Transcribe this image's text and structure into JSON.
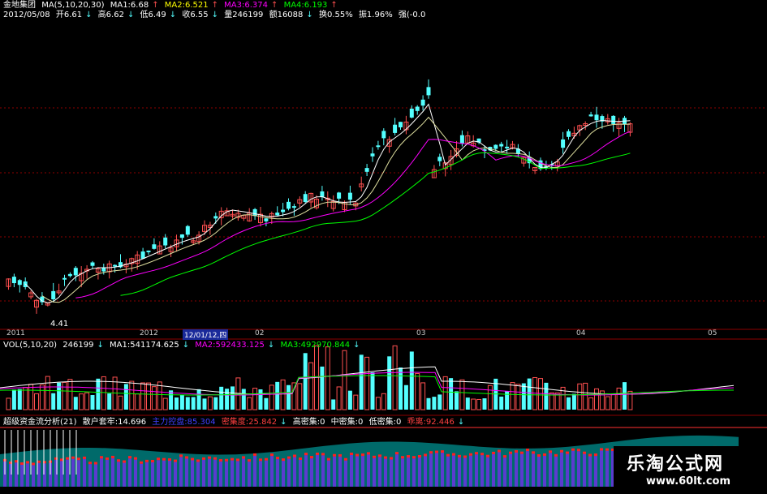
{
  "title_bar": {
    "stock_name": "金地集团",
    "ma_spec": "MA(5,10,20,30)",
    "ma1": "MA1:6.68",
    "ma2": "MA2:6.521",
    "ma3": "MA3:6.374",
    "ma4": "MA4:6.193"
  },
  "quote_bar": {
    "date": "2012/05/08",
    "open": "开6.61",
    "high": "高6.62",
    "low": "低6.49",
    "close": "收6.55",
    "volume": "量246199",
    "amount": "额16088",
    "turnover": "换0.55%",
    "amplitude": "振1.96%",
    "strength": "强(-0.0"
  },
  "price_panel": {
    "low_label": "4.41"
  },
  "time_axis": {
    "labels": [
      "2011",
      "2012",
      "02",
      "03",
      "04",
      "05"
    ],
    "cursor_label": "12/01/12,四"
  },
  "volume_panel": {
    "spec": "VOL(5,10,20)",
    "value": "246199",
    "ma1": "MA1:541174.625",
    "ma2": "MA2:592433.125",
    "ma3": "MA3:492970.844"
  },
  "indicator_panel": {
    "name": "超级资金流分析(21)",
    "retail": "散户套牢:14.696",
    "main_control": "主力控盘:85.304",
    "density": "密集度:25.842",
    "high_dense": "高密集:0",
    "mid_dense": "中密集:0",
    "low_dense": "低密集:0",
    "surge": "乖离:92.446"
  },
  "watermark": {
    "brand": "乐淘公式网",
    "url": "www.60lt.com"
  },
  "colors": {
    "up": "#ff5050",
    "down": "#54ffff",
    "ma1": "#ffffff",
    "ma2": "#ffff00",
    "ma3": "#ff00ff",
    "ma4": "#00ff00",
    "grid": "#8c0000",
    "axis_text": "#c8c8c8"
  }
}
